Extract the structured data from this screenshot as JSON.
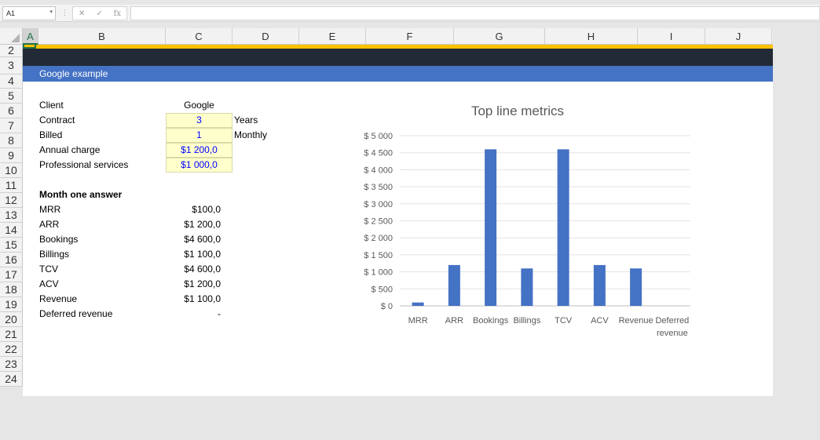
{
  "formula_bar": {
    "name_box": "A1",
    "fx": "fx"
  },
  "columns": [
    "A",
    "B",
    "C",
    "D",
    "E",
    "F",
    "G",
    "H",
    "I",
    "J"
  ],
  "rows": [
    "2",
    "3",
    "4",
    "5",
    "6",
    "7",
    "8",
    "9",
    "10",
    "11",
    "12",
    "13",
    "14",
    "15",
    "16",
    "17",
    "18",
    "19",
    "20",
    "21",
    "22",
    "23",
    "24"
  ],
  "sheet": {
    "title_row": "Google example",
    "inputs": [
      {
        "label": "Client",
        "value": "Google",
        "unit": ""
      },
      {
        "label": "Contract",
        "value": "3",
        "unit": "Years"
      },
      {
        "label": "Billed",
        "value": "1",
        "unit": "Monthly"
      },
      {
        "label": "Annual charge",
        "value": "$1 200,0",
        "unit": ""
      },
      {
        "label": "Professional services",
        "value": "$1 000,0",
        "unit": ""
      }
    ],
    "answer_heading": "Month one answer",
    "answers": [
      {
        "label": "MRR",
        "value": "$100,0"
      },
      {
        "label": "ARR",
        "value": "$1 200,0"
      },
      {
        "label": "Bookings",
        "value": "$4 600,0"
      },
      {
        "label": "Billings",
        "value": "$1 100,0"
      },
      {
        "label": "TCV",
        "value": "$4 600,0"
      },
      {
        "label": "ACV",
        "value": "$1 200,0"
      },
      {
        "label": "Revenue",
        "value": "$1 100,0"
      },
      {
        "label": "Deferred revenue",
        "value": "-"
      }
    ]
  },
  "chart_data": {
    "type": "bar",
    "title": "Top line metrics",
    "categories": [
      "MRR",
      "ARR",
      "Bookings",
      "Billings",
      "TCV",
      "ACV",
      "Revenue",
      "Deferred revenue"
    ],
    "values": [
      100,
      1200,
      4600,
      1100,
      4600,
      1200,
      1100,
      0
    ],
    "ylim": [
      0,
      5000
    ],
    "yticks": [
      "$ 0",
      "$ 500",
      "$ 1 000",
      "$ 1 500",
      "$ 2 000",
      "$ 2 500",
      "$ 3 000",
      "$ 3 500",
      "$ 4 000",
      "$ 4 500",
      "$ 5 000"
    ],
    "grid": true,
    "bar_color": "#4472c4"
  },
  "colors": {
    "header_band": "#222a35",
    "accent": "#ffc000",
    "title_band": "#4472c4",
    "input_fill": "#ffffcc"
  }
}
